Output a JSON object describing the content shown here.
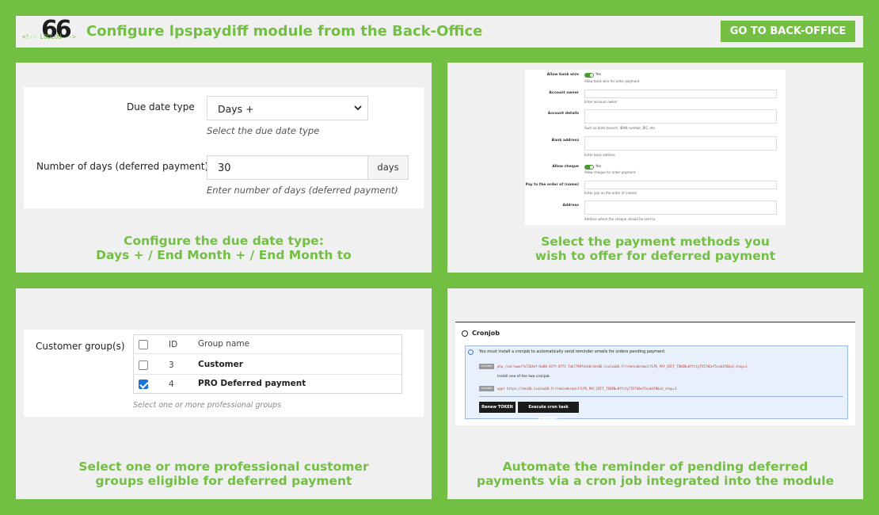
{
  "header": {
    "logo_number": "66",
    "logo_tag": "<!-- LOULOU -->",
    "title": "Configure lpspaydiff module from the Back-Office",
    "button_label": "GO TO BACK-OFFICE"
  },
  "panel1": {
    "due_date_label": "Due date type",
    "due_date_value": "Days +",
    "due_date_help": "Select the due date type",
    "days_label": "Number of days (deferred payment)",
    "days_value": "30",
    "days_addon": "days",
    "days_help": "Enter number of days (deferred payment)",
    "caption_line1": "Configure the due date type:",
    "caption_line2": "Days + / End Month + / End Month to"
  },
  "panel2": {
    "fields": [
      {
        "label": "Allow bank wire",
        "type": "toggle",
        "value": "Yes",
        "help": "Allow bank wire for order payment"
      },
      {
        "label": "Account owner",
        "type": "input",
        "help": "Enter account owner"
      },
      {
        "label": "Account details",
        "type": "input",
        "help": "Such as bank branch, IBAN number, BIC, etc."
      },
      {
        "label": "Bank address",
        "type": "input",
        "help": "Enter bank address"
      },
      {
        "label": "Allow cheque",
        "type": "toggle",
        "value": "Yes",
        "help": "Allow cheque for order payment"
      },
      {
        "label": "Pay to the order of (name)",
        "type": "input",
        "help": "Enter pay on the order of (name)"
      },
      {
        "label": "Address",
        "type": "input",
        "help": "Address where the cheque should be sent to."
      }
    ],
    "caption_line1": "Select the payment methods you",
    "caption_line2": "wish to offer for deferred payment"
  },
  "panel3": {
    "group_label": "Customer group(s)",
    "columns": {
      "id": "ID",
      "name": "Group name"
    },
    "rows": [
      {
        "id": "3",
        "name": "Customer",
        "checked": false
      },
      {
        "id": "4",
        "name": "PRO Deferred payment",
        "checked": true
      }
    ],
    "help": "Select one or more professional groups",
    "caption_line1": "Select one or more professional customer",
    "caption_line2": "groups eligible for deferred payment"
  },
  "panel4": {
    "title": "Cronjob",
    "alert_text": "You must install a cronjob to automatically send reminder emails for orders pending payment.",
    "tag1": "Crontab",
    "code1": "php /var/www/fe7264ef-6a80-42ff-87f1-7ab7799f4cb8/dev66.loulou66.fr/remindermail?LPS_PAY_DIFF_TOKEN=0ffcty7557d6ef5ceb3f8&id_shop=1",
    "install_text": "Install one of the two cronjob",
    "tag2": "Crontab",
    "code2": "wget https://dev66.loulou66.fr/remindermail?LPS_PAY_DIFF_TOKEN=0ffcty7557d6ef5ceb3f8&id_shop=1",
    "btn_renew": "Renew TOKEN",
    "btn_execute": "Execute cron task manually",
    "caption_line1": "Automate the reminder of pending deferred",
    "caption_line2": "payments via a cron job integrated into the module"
  },
  "colors": {
    "brand_green": "#72bf44",
    "panel_bg": "#f0f0f0",
    "checkbox_blue": "#1a73d9"
  }
}
